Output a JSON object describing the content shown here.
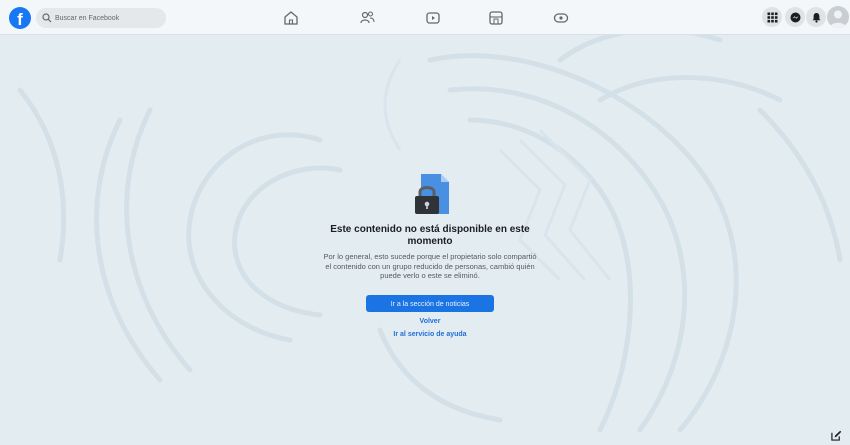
{
  "header": {
    "logo_letter": "f",
    "search_placeholder": "Buscar en Facebook"
  },
  "nav_icons": [
    "home-icon",
    "friends-icon",
    "watch-icon",
    "marketplace-icon",
    "gaming-icon"
  ],
  "right_icons": [
    "menu-grid-icon",
    "messenger-icon",
    "notifications-icon",
    "account-avatar"
  ],
  "main": {
    "title": "Este contenido no está disponible en este momento",
    "description": "Por lo general, esto sucede porque el propietario solo compartió el contenido con un grupo reducido de personas, cambió quién puede verlo o este se eliminó.",
    "primary_button": "Ir a la sección de noticias",
    "back_link": "Volver",
    "help_link": "Ir al servicio de ayuda"
  },
  "colors": {
    "brand": "#1877f2",
    "button": "#1b74e4",
    "link": "#216fdb",
    "background": "#e3ecf1"
  }
}
